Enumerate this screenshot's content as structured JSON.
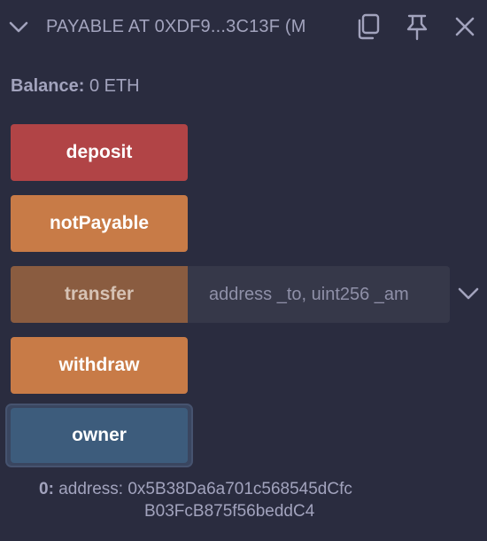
{
  "header": {
    "title": "PAYABLE AT 0XDF9...3C13F (M",
    "collapse_icon": "chevron-down-icon",
    "copy_icon": "copy-icon",
    "pin_icon": "pin-icon",
    "close_icon": "close-icon"
  },
  "balance": {
    "label": "Balance:",
    "value": "0 ETH"
  },
  "functions": {
    "deposit": {
      "label": "deposit",
      "color": "#b14446"
    },
    "notPayable": {
      "label": "notPayable",
      "color": "#c87b47"
    },
    "transfer": {
      "label": "transfer",
      "color": "#8a5c40",
      "args_placeholder": "address _to, uint256 _am",
      "args_value": "",
      "expand_icon": "chevron-down-icon"
    },
    "withdraw": {
      "label": "withdraw",
      "color": "#c87b47"
    },
    "owner": {
      "label": "owner",
      "color": "#3d5c7c"
    }
  },
  "output": {
    "index": "0:",
    "line1": "address: 0x5B38Da6a701c568545dCfc",
    "line2": "B03FcB875f56beddC4"
  }
}
